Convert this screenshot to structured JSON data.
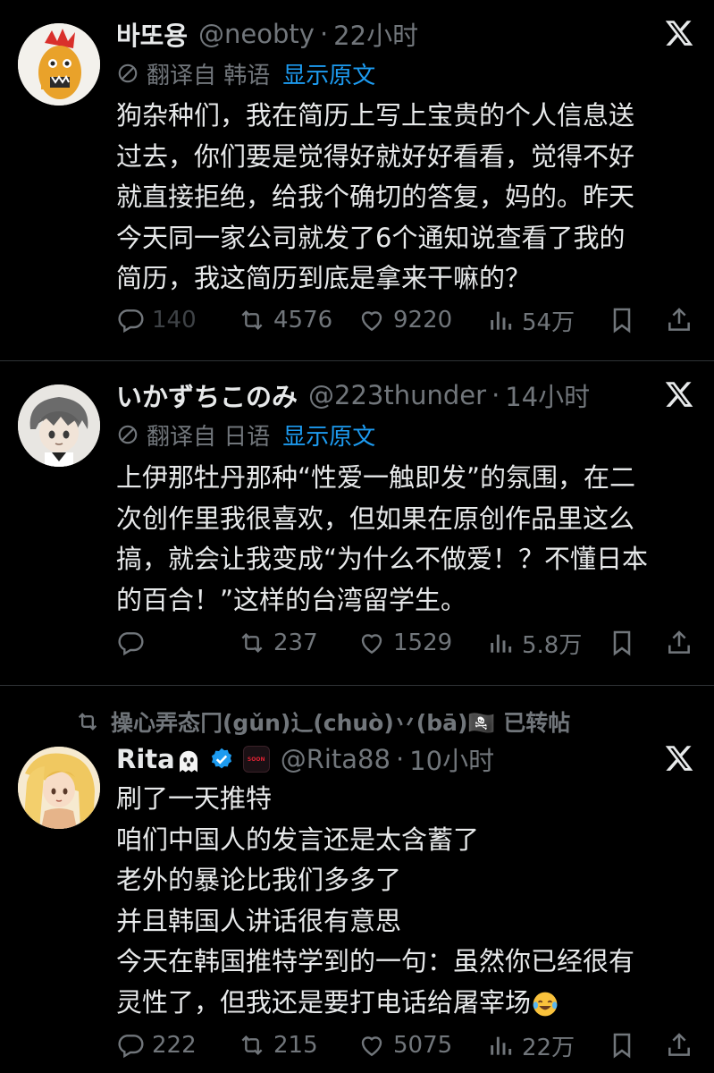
{
  "tweets": [
    {
      "display_name": "바또용",
      "handle": "@neobty",
      "time": "22小时",
      "translate_label": "翻译自 韩语",
      "show_original": "显示原文",
      "lines": [
        "狗杂种们，我在简历上写上宝贵的个人信息送",
        "过去，你们要是觉得好就好好看看，觉得不好",
        "就直接拒绝，给我个确切的答复，妈的。昨天",
        "今天同一家公司就发了6个通知说查看了我的",
        "简历，我这简历到底是拿来干嘛的？"
      ],
      "stats": {
        "replies": "140",
        "retweets": "4576",
        "likes": "9220",
        "views": "54万"
      }
    },
    {
      "display_name": "いかずちこのみ",
      "handle": "@223thunder",
      "time": "14小时",
      "translate_label": "翻译自 日语",
      "show_original": "显示原文",
      "lines": [
        "上伊那牡丹那种“性爱一触即发”的氛围，在二",
        "次创作里我很喜欢，但如果在原创作品里这么",
        "搞，就会让我变成“为什么不做爱！？不懂日本",
        "的百合！”这样的台湾留学生。"
      ],
      "stats": {
        "replies": "",
        "retweets": "237",
        "likes": "1529",
        "views": "5.8万"
      }
    },
    {
      "retweeted_by": "操心弄态冂(gǔn)辶(chuò)丷(bā)🏴‍☠️ 已转帖",
      "display_name": "Rita",
      "handle": "@Rita88",
      "time": "10小时",
      "brand_badge_text": "SOON",
      "lines": [
        "刷了一天推特",
        "咱们中国人的发言还是太含蓄了",
        "老外的暴论比我们多多了",
        "并且韩国人讲话很有意思",
        "今天在韩国推特学到的一句：虽然你已经很有",
        "灵性了，但我还是要打电话给屠宰场"
      ],
      "stats": {
        "replies": "222",
        "retweets": "215",
        "likes": "5075",
        "views": "22万"
      }
    }
  ],
  "icons": {
    "reply": "reply-icon",
    "retweet": "retweet-icon",
    "like": "heart-icon",
    "views": "views-icon",
    "bookmark": "bookmark-icon",
    "share": "share-icon",
    "x": "x-logo-icon",
    "translate": "translate-icon",
    "verified": "verified-badge-icon"
  },
  "colors": {
    "background": "#000000",
    "text": "#e7e9ea",
    "muted": "#71767b",
    "link": "#1d9bf0",
    "divider": "#2f3336",
    "verified": "#1d9bf0"
  }
}
